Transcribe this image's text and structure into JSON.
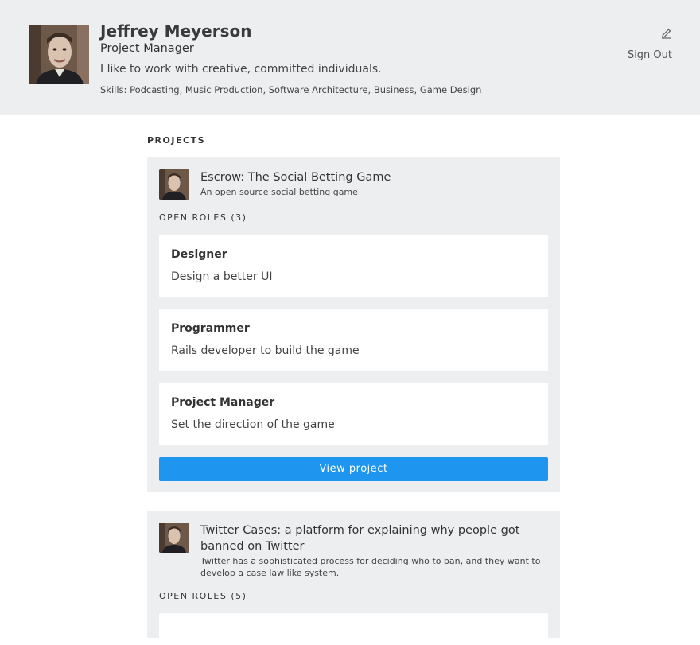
{
  "profile": {
    "name": "Jeffrey Meyerson",
    "title": "Project Manager",
    "bio": "I like to work with creative, committed individuals.",
    "skills": "Skills: Podcasting, Music Production, Software Architecture, Business, Game Design",
    "edit_icon": "pencil-icon",
    "sign_out_label": "Sign Out"
  },
  "projects_heading": "PROJECTS",
  "projects": [
    {
      "title": "Escrow: The Social Betting Game",
      "description": "An open source social betting game",
      "roles_heading": "OPEN ROLES (3)",
      "roles": [
        {
          "name": "Designer",
          "description": "Design a better UI"
        },
        {
          "name": "Programmer",
          "description": "Rails developer to build the game"
        },
        {
          "name": "Project Manager",
          "description": "Set the direction of the game"
        }
      ],
      "button_label": "View project"
    },
    {
      "title": "Twitter Cases: a platform for explaining why people got banned on Twitter",
      "description": "Twitter has a sophisticated process for deciding who to ban, and they want to develop a case law like system.",
      "roles_heading": "OPEN ROLES (5)"
    }
  ],
  "colors": {
    "header_bg": "#eceef0",
    "card_bg": "#eceef0",
    "accent": "#1e96f0"
  }
}
